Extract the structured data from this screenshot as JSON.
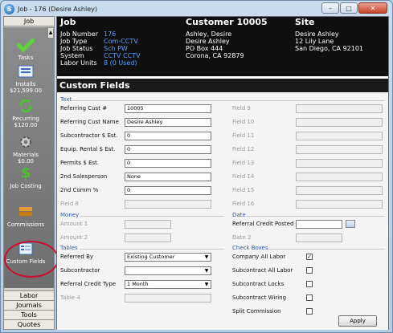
{
  "window": {
    "title": "Job - 176 (Desire Ashley)"
  },
  "nav": {
    "header": "Job",
    "items": [
      {
        "label": "Tasks",
        "icon": "checkmark-icon"
      },
      {
        "label": "Installs\n$21,599.00",
        "icon": "installs-icon"
      },
      {
        "label": "Recurring\n$120.00",
        "icon": "recurring-icon"
      },
      {
        "label": "Materials\n$0.00",
        "icon": "gear-icon"
      },
      {
        "label": "Job Costing",
        "icon": "dollar-icon"
      },
      {
        "label": "Commissions",
        "icon": "commissions-icon"
      },
      {
        "label": "Custom Fields",
        "icon": "custom-fields-icon"
      }
    ],
    "bottom": [
      "Labor",
      "Journals",
      "Tools",
      "Quotes"
    ]
  },
  "job": {
    "heading": "Job",
    "customer_heading": "Customer 10005",
    "site_heading": "Site",
    "rows": [
      {
        "label": "Job Number",
        "value": "176"
      },
      {
        "label": "Job Type",
        "value": "Com-CCTV"
      },
      {
        "label": "Job Status",
        "value": "Sch PW"
      },
      {
        "label": "System",
        "value": "CCTV CCTV"
      },
      {
        "label": "Labor Units",
        "value": "8 (0 Used)"
      }
    ],
    "customer_lines": [
      "Ashley, Desire",
      "Desire Ashley",
      "PO Box 444",
      "Corona, CA  92879"
    ],
    "site_lines": [
      "Desire Ashley",
      "12 Lily Lane",
      "San Diego, CA  92101"
    ]
  },
  "custom_fields": {
    "title": "Custom Fields",
    "text_section": "Text",
    "text_fields": [
      {
        "label": "Referring Cust #",
        "value": "10005"
      },
      {
        "label": "Referring Cust Name",
        "value": "Desire Ashley"
      },
      {
        "label": "Subcontractor $ Est.",
        "value": "0"
      },
      {
        "label": "Equip. Rental $ Est.",
        "value": "0"
      },
      {
        "label": "Permits $ Est.",
        "value": "0"
      },
      {
        "label": "2nd Salesperson",
        "value": "None"
      },
      {
        "label": "2nd Comm %",
        "value": "0"
      },
      {
        "label": "Field 8",
        "value": ""
      }
    ],
    "text_fields_right": [
      "Field 9",
      "Field 10",
      "Field 11",
      "Field 12",
      "Field 13",
      "Field 14",
      "Field 15",
      "Field 16"
    ],
    "money_section": "Money",
    "money_fields": [
      "Amount 1",
      "Amount 2"
    ],
    "date_section": "Date",
    "date_fields": [
      "Referral Credit Posted",
      "Date 2"
    ],
    "tables_section": "Tables",
    "table_fields": [
      {
        "label": "Referred By",
        "value": "Existing Customer"
      },
      {
        "label": "Subcontractor",
        "value": ""
      },
      {
        "label": "Referral Credit Type",
        "value": "1 Month"
      },
      {
        "label": "Table 4",
        "value": ""
      }
    ],
    "checkbox_section": "Check Boxes",
    "checkboxes": [
      {
        "label": "Company All Labor",
        "checked": "✓"
      },
      {
        "label": "Subcontract All Labor",
        "checked": ""
      },
      {
        "label": "Subcontract Locks",
        "checked": ""
      },
      {
        "label": "Subcontract Wiring",
        "checked": ""
      },
      {
        "label": "Split Commission",
        "checked": ""
      }
    ],
    "apply_label": "Apply"
  }
}
